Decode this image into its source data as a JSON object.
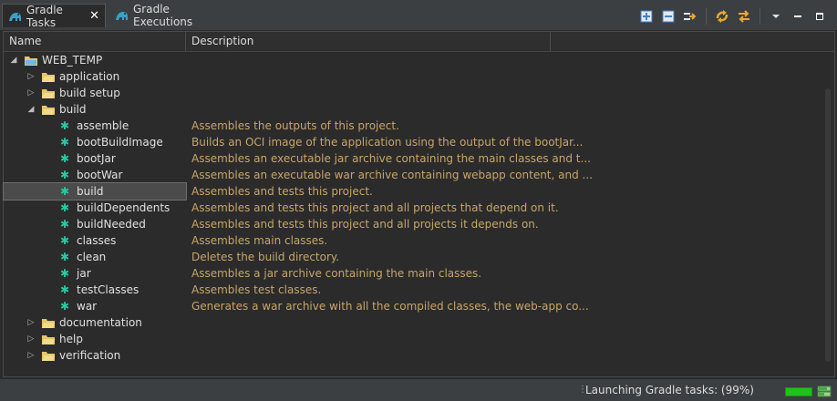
{
  "tabs": [
    {
      "label": "Gradle Tasks",
      "active": true,
      "closable": true
    },
    {
      "label": "Gradle Executions",
      "active": false
    }
  ],
  "toolbar": {
    "buttons": [
      "expand-all-icon",
      "collapse-all-icon",
      "link-with-selection-icon",
      "refresh-icon",
      "toggle-filter-icon",
      "view-menu-icon",
      "minimize-icon",
      "maximize-icon"
    ]
  },
  "columns": {
    "name": "Name",
    "description": "Description"
  },
  "tree": {
    "root": "WEB_TEMP",
    "groups": {
      "application": "application",
      "build_setup": "build setup",
      "build": "build",
      "documentation": "documentation",
      "help": "help",
      "verification": "verification"
    },
    "build_tasks": [
      {
        "name": "assemble",
        "description": "Assembles the outputs of this project."
      },
      {
        "name": "bootBuildImage",
        "description": "Builds an OCI image of the application using the output of the bootJar..."
      },
      {
        "name": "bootJar",
        "description": "Assembles an executable jar archive containing the main classes and t..."
      },
      {
        "name": "bootWar",
        "description": "Assembles an executable war archive containing webapp content, and ..."
      },
      {
        "name": "build",
        "description": "Assembles and tests this project.",
        "selected": true
      },
      {
        "name": "buildDependents",
        "description": "Assembles and tests this project and all projects that depend on it."
      },
      {
        "name": "buildNeeded",
        "description": "Assembles and tests this project and all projects it depends on."
      },
      {
        "name": "classes",
        "description": "Assembles main classes."
      },
      {
        "name": "clean",
        "description": "Deletes the build directory."
      },
      {
        "name": "jar",
        "description": "Assembles a jar archive containing the main classes."
      },
      {
        "name": "testClasses",
        "description": "Assembles test classes."
      },
      {
        "name": "war",
        "description": "Generates a war archive with all the compiled classes, the web-app co..."
      }
    ]
  },
  "status": {
    "text": "Launching Gradle tasks: (99%)",
    "progress": 0.99
  },
  "colors": {
    "description_text": "#c8a56a",
    "task_icon": "#2cc7a2",
    "folder": "#e8c46a",
    "progress": "#21c21f"
  }
}
